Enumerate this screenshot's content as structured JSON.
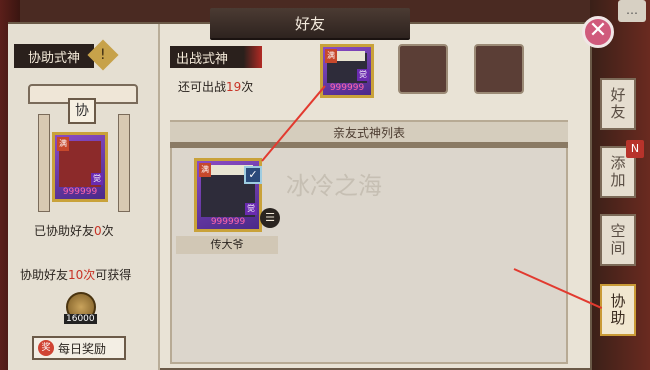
{
  "header": {
    "title": "好友"
  },
  "close": {
    "glyph": "✕"
  },
  "chat_icon": "chat-bubble-icon",
  "left": {
    "section_title": "协助式神",
    "warn_glyph": "!",
    "shrine_sign": "协",
    "card": {
      "stars": "999999",
      "level_badge": "满",
      "awaken_badge": "觉"
    },
    "assisted_prefix": "已协助好友",
    "assisted_count": "0",
    "assisted_suffix": "次",
    "reward_prefix": "协助好友",
    "reward_count": "10次",
    "reward_suffix": "可获得",
    "coin_amount": "16000",
    "daily_label": "每日奖励",
    "daily_icon_glyph": "奖"
  },
  "battle": {
    "label": "出战式神",
    "remaining_prefix": "还可出战",
    "remaining_count": "19",
    "remaining_suffix": "次",
    "card": {
      "stars": "999999",
      "level_badge": "满",
      "awaken_badge": "觉"
    }
  },
  "list": {
    "header": "亲友式神列表",
    "card": {
      "stars": "999999",
      "level_badge": "满",
      "awaken_badge": "觉",
      "name": "传大爷",
      "check_glyph": "✓",
      "menu_glyph": "☰"
    },
    "watermark": "冰冷之海"
  },
  "tabs": [
    {
      "label": "好友"
    },
    {
      "label": "添加",
      "badge": "N"
    },
    {
      "label": "空间"
    },
    {
      "label": "协助",
      "active": true
    }
  ],
  "colors": {
    "accent_red": "#c83326",
    "card_purple": "#6b3db0",
    "gold": "#c9a23a"
  }
}
